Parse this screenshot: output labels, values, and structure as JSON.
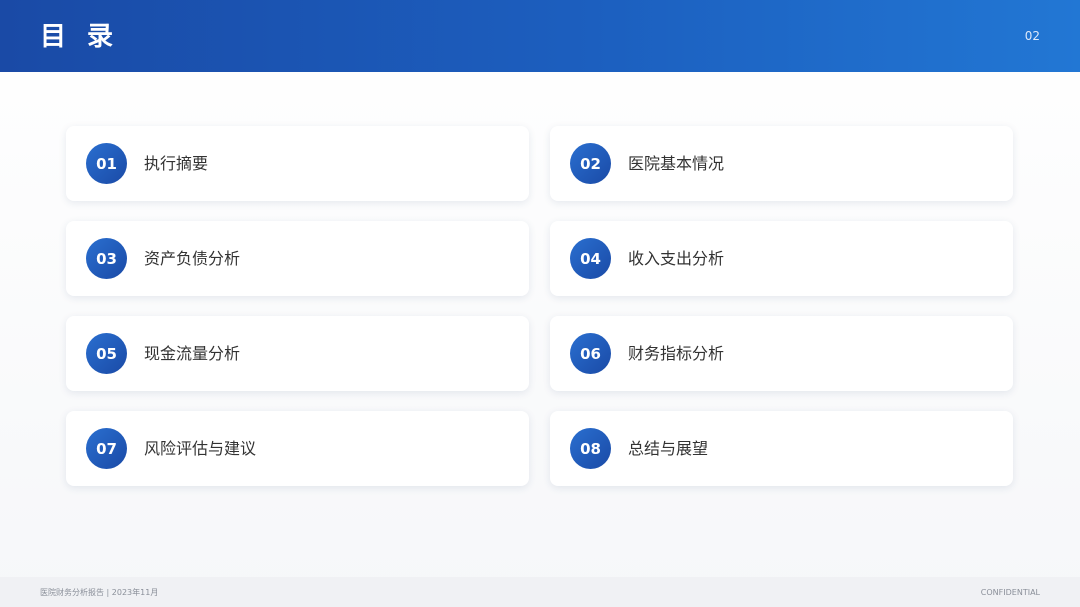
{
  "header": {
    "title": "目 录",
    "page_number": "02"
  },
  "toc": {
    "items": [
      {
        "number": "01",
        "label": "执行摘要"
      },
      {
        "number": "02",
        "label": "医院基本情况"
      },
      {
        "number": "03",
        "label": "资产负债分析"
      },
      {
        "number": "04",
        "label": "收入支出分析"
      },
      {
        "number": "05",
        "label": "现金流量分析"
      },
      {
        "number": "06",
        "label": "财务指标分析"
      },
      {
        "number": "07",
        "label": "风险评估与建议"
      },
      {
        "number": "08",
        "label": "总结与展望"
      }
    ]
  },
  "footer": {
    "left_text": "医院财务分析报告 | 2023年11月",
    "right_text": "CONFIDENTIAL"
  },
  "colors": {
    "header_start": "#1a4aa6",
    "header_end": "#2277d4",
    "badge": "#1f5cc0"
  }
}
